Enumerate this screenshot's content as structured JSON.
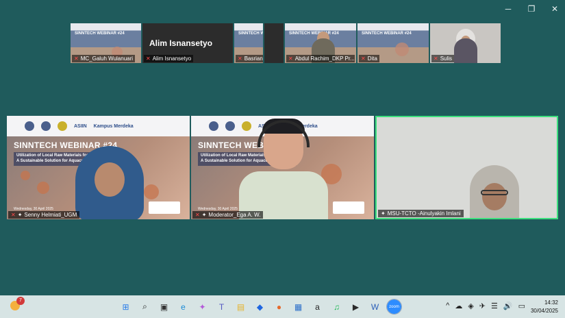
{
  "window_controls": {
    "minimize": "─",
    "restore": "❐",
    "close": "✕"
  },
  "strip": {
    "slide_title": "SINNTECH WEBINAR #24",
    "big_name": "Alim Isnansetyo",
    "tiles": [
      {
        "name": "MC_Galuh Wulanuari"
      },
      {
        "name": "Alim Isnansetyo"
      },
      {
        "name": "Basriani"
      },
      {
        "name": "Abdul Rachim_DKP Pr..."
      },
      {
        "name": "Dita"
      },
      {
        "name": "Sulis"
      }
    ]
  },
  "slide": {
    "title": "SINNTECH WEBINAR #24",
    "subtitle_line1": "Utilization of Local Raw Materials for Fish Feed:",
    "subtitle_line2": "A Sustainable Solution for Aquaculture",
    "date": "Wednesday, 30 April 2025",
    "logo_text_1": "ASIIN",
    "logo_text_2": "Kampus Merdeka"
  },
  "main": {
    "tiles": [
      {
        "name": "Senny Helmiati_UGM"
      },
      {
        "name": "Moderator_Ega A. W."
      },
      {
        "name": "MSU-TCTO -Ainulyakin Imlani"
      }
    ]
  },
  "taskbar": {
    "weather_badge": "7",
    "apps": [
      {
        "icon": "windows-start-icon",
        "glyph": "⊞",
        "color": "#2b7de9"
      },
      {
        "icon": "search-icon",
        "glyph": "⌕",
        "color": "#222222"
      },
      {
        "icon": "task-view-icon",
        "glyph": "▣",
        "color": "#333333"
      },
      {
        "icon": "edge-icon",
        "glyph": "e",
        "color": "#1b8ad6"
      },
      {
        "icon": "copilot-icon",
        "glyph": "✦",
        "color": "#b45ad8"
      },
      {
        "icon": "teams-icon",
        "glyph": "T",
        "color": "#5458c2"
      },
      {
        "icon": "file-explorer-icon",
        "glyph": "▤",
        "color": "#e6b32c"
      },
      {
        "icon": "dropbox-icon",
        "glyph": "◆",
        "color": "#1f66e0"
      },
      {
        "icon": "firefox-icon",
        "glyph": "●",
        "color": "#e66a2c"
      },
      {
        "icon": "store-icon",
        "glyph": "▦",
        "color": "#2c6fc9"
      },
      {
        "icon": "amazon-icon",
        "glyph": "a",
        "color": "#222222"
      },
      {
        "icon": "spotify-icon",
        "glyph": "♫",
        "color": "#1db954"
      },
      {
        "icon": "media-player-icon",
        "glyph": "▶",
        "color": "#2a2a2a"
      },
      {
        "icon": "word-icon",
        "glyph": "W",
        "color": "#2b5fb8"
      },
      {
        "icon": "zoom-icon",
        "glyph": "zoom",
        "color": "#2d8cff"
      }
    ],
    "tray": [
      "^",
      "☁",
      "◈",
      "✈",
      "☰",
      "🔊",
      "▭"
    ],
    "time": "14:32",
    "date": "30/04/2025"
  }
}
